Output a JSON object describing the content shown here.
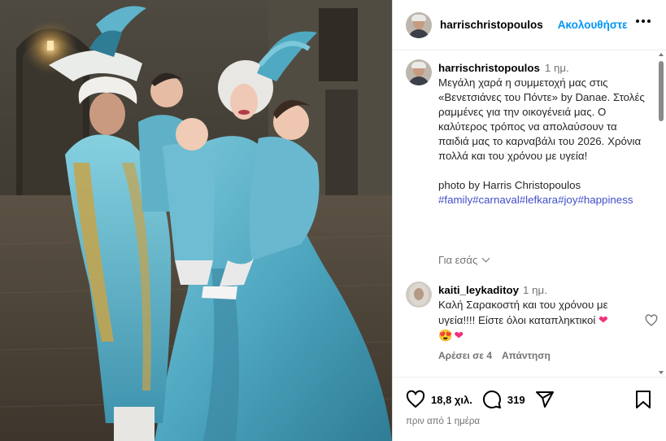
{
  "post": {
    "author": "harrischristopoulos",
    "follow_label": "Ακολουθήστε",
    "caption_time": "1 ημ.",
    "caption_text": "Μεγάλη χαρά η συμμετοχή μας στις «Βενετσιάνες του Πόντε» by Danae. Στολές ραμμένες για την οικογένειά μας. Ο καλύτερος τρόπος να απολαύσουν τα παιδιά μας το καρναβάλι του 2026. Χρόνια πολλά και του χρόνου με υγεία!",
    "photo_credit": "photo by Harris Christopoulos",
    "hashtags": "#family#carnaval#lefkara#joy#happiness",
    "translate_label": "Για εσάς"
  },
  "comment": {
    "author": "kaiti_leykaditoy",
    "time": "1 ημ.",
    "text": "Καλή Σαρακοστή και του χρόνου με υγεία!!!! Είστε όλοι καταπληκτικοί",
    "emojis": "❤😍❤",
    "likes_label": "Αρέσει σε 4",
    "reply_label": "Απάντηση"
  },
  "footer": {
    "likes_count": "18,8 χιλ.",
    "comments_count": "319",
    "posted_ago": "πριν από 1 ημέρα"
  },
  "icons": {
    "more": "more-dots-icon",
    "like": "heart-icon",
    "comment": "comment-bubble-icon",
    "share": "send-icon",
    "save": "bookmark-icon"
  },
  "colors": {
    "link_blue": "#0095f6",
    "hashtag": "#3f4fc9",
    "muted": "#737373",
    "costume_teal": "#5fb1c8"
  }
}
